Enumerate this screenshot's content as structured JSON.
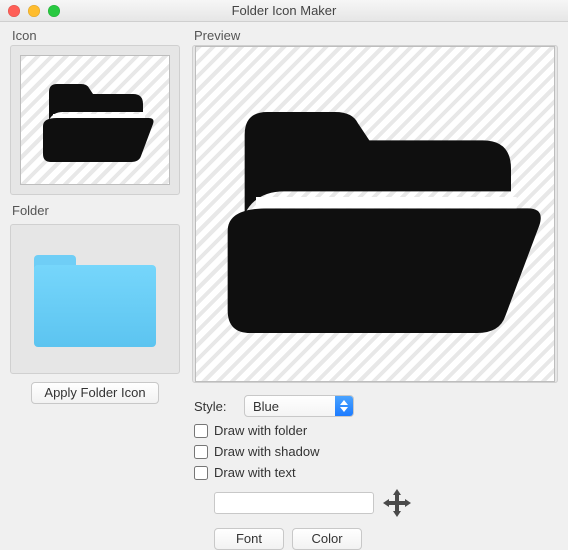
{
  "window": {
    "title": "Folder Icon Maker"
  },
  "sections": {
    "icon_label": "Icon",
    "folder_label": "Folder",
    "preview_label": "Preview"
  },
  "buttons": {
    "apply": "Apply Folder Icon",
    "font": "Font",
    "color": "Color"
  },
  "style": {
    "label": "Style:",
    "selected": "Blue"
  },
  "options": {
    "draw_folder": {
      "label": "Draw with folder",
      "checked": false
    },
    "draw_shadow": {
      "label": "Draw with shadow",
      "checked": false
    },
    "draw_text": {
      "label": "Draw with text",
      "checked": false
    }
  },
  "text_input": {
    "value": "",
    "placeholder": ""
  },
  "colors": {
    "folder_blue_top": "#76d6fb",
    "folder_blue_bottom": "#5cc4f0",
    "folder_tab": "#6fcef6",
    "icon_glyph": "#0f0f0f"
  }
}
